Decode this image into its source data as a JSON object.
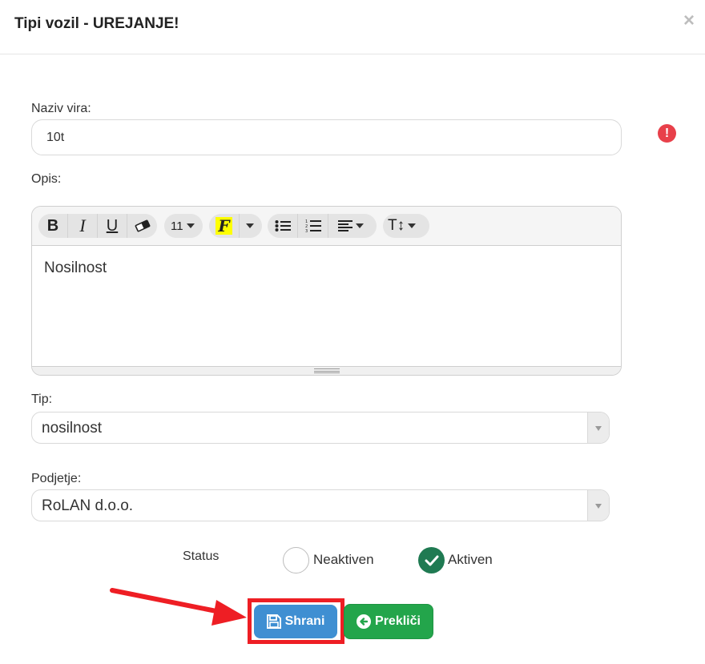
{
  "modal": {
    "title": "Tipi vozil - UREJANJE!",
    "close_symbol": "×"
  },
  "form": {
    "naziv": {
      "label": "Naziv vira:",
      "value": "10t"
    },
    "opis": {
      "label": "Opis:",
      "content": "Nosilnost",
      "toolbar": {
        "bold": "B",
        "italic": "I",
        "underline": "U",
        "font_size": "11",
        "font_style_glyph": "F",
        "text_height_glyph": "T↕"
      }
    },
    "tip": {
      "label": "Tip:",
      "selected": "nosilnost"
    },
    "podjetje": {
      "label": "Podjetje:",
      "selected": "RoLAN d.o.o."
    },
    "status": {
      "label": "Status",
      "options": [
        {
          "label": "Neaktiven",
          "checked": false
        },
        {
          "label": "Aktiven",
          "checked": true
        }
      ]
    }
  },
  "buttons": {
    "save": "Shrani",
    "cancel": "Prekliči"
  },
  "colors": {
    "save_button": "#3f8fd2",
    "cancel_button": "#23a54b",
    "active_radio": "#1f7a52",
    "annotation": "#ee1e24",
    "alert": "#e8404a",
    "highlight_f": "#ffff00"
  },
  "icons": [
    "close-icon",
    "alert-icon",
    "bold-icon",
    "italic-icon",
    "underline-icon",
    "eraser-icon",
    "font-style-icon",
    "bullet-list-icon",
    "numbered-list-icon",
    "align-icon",
    "text-height-icon",
    "save-icon",
    "arrow-left-circle-icon",
    "check-icon"
  ]
}
